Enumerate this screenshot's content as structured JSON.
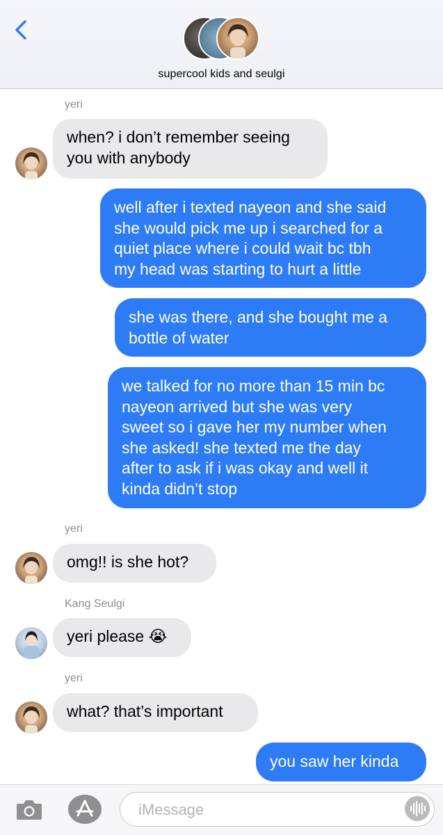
{
  "header": {
    "title": "supercool kids and seulgi",
    "back_icon": "chevron-left-icon",
    "accent": "#2d7cf6"
  },
  "messages": [
    {
      "sender": "yeri",
      "side": "in",
      "text": "when? i don’t remember seeing\nyou with anybody"
    },
    {
      "side": "out",
      "text": "well after i texted nayeon and she said\nshe would pick me up i searched for a\nquiet place where i could wait bc tbh\nmy head was starting to hurt a little"
    },
    {
      "side": "out",
      "text": "she was there, and she bought me a\nbottle of water"
    },
    {
      "side": "out",
      "text": "we talked for no more than 15 min bc\nnayeon arrived but she was very\nsweet so i gave her my number when\nshe asked! she texted me the day\nafter to ask if i was okay and well it\nkinda didn’t stop"
    },
    {
      "sender": "yeri",
      "side": "in",
      "text": "omg!! is she hot?"
    },
    {
      "sender": "Kang Seulgi",
      "side": "in",
      "text": "yeri please 😭"
    },
    {
      "sender": "yeri",
      "side": "in",
      "text": "what? that’s important"
    },
    {
      "side": "out",
      "text": "you saw her kinda"
    }
  ],
  "toolbar": {
    "placeholder": "iMessage",
    "camera_icon": "camera-icon",
    "apps_icon": "app-store-icon",
    "audio_icon": "audio-waveform-icon"
  },
  "colors": {
    "outgoing_bubble": "#2d7cf6",
    "incoming_bubble": "#e9e9eb",
    "sender_label": "#8e8e93"
  }
}
